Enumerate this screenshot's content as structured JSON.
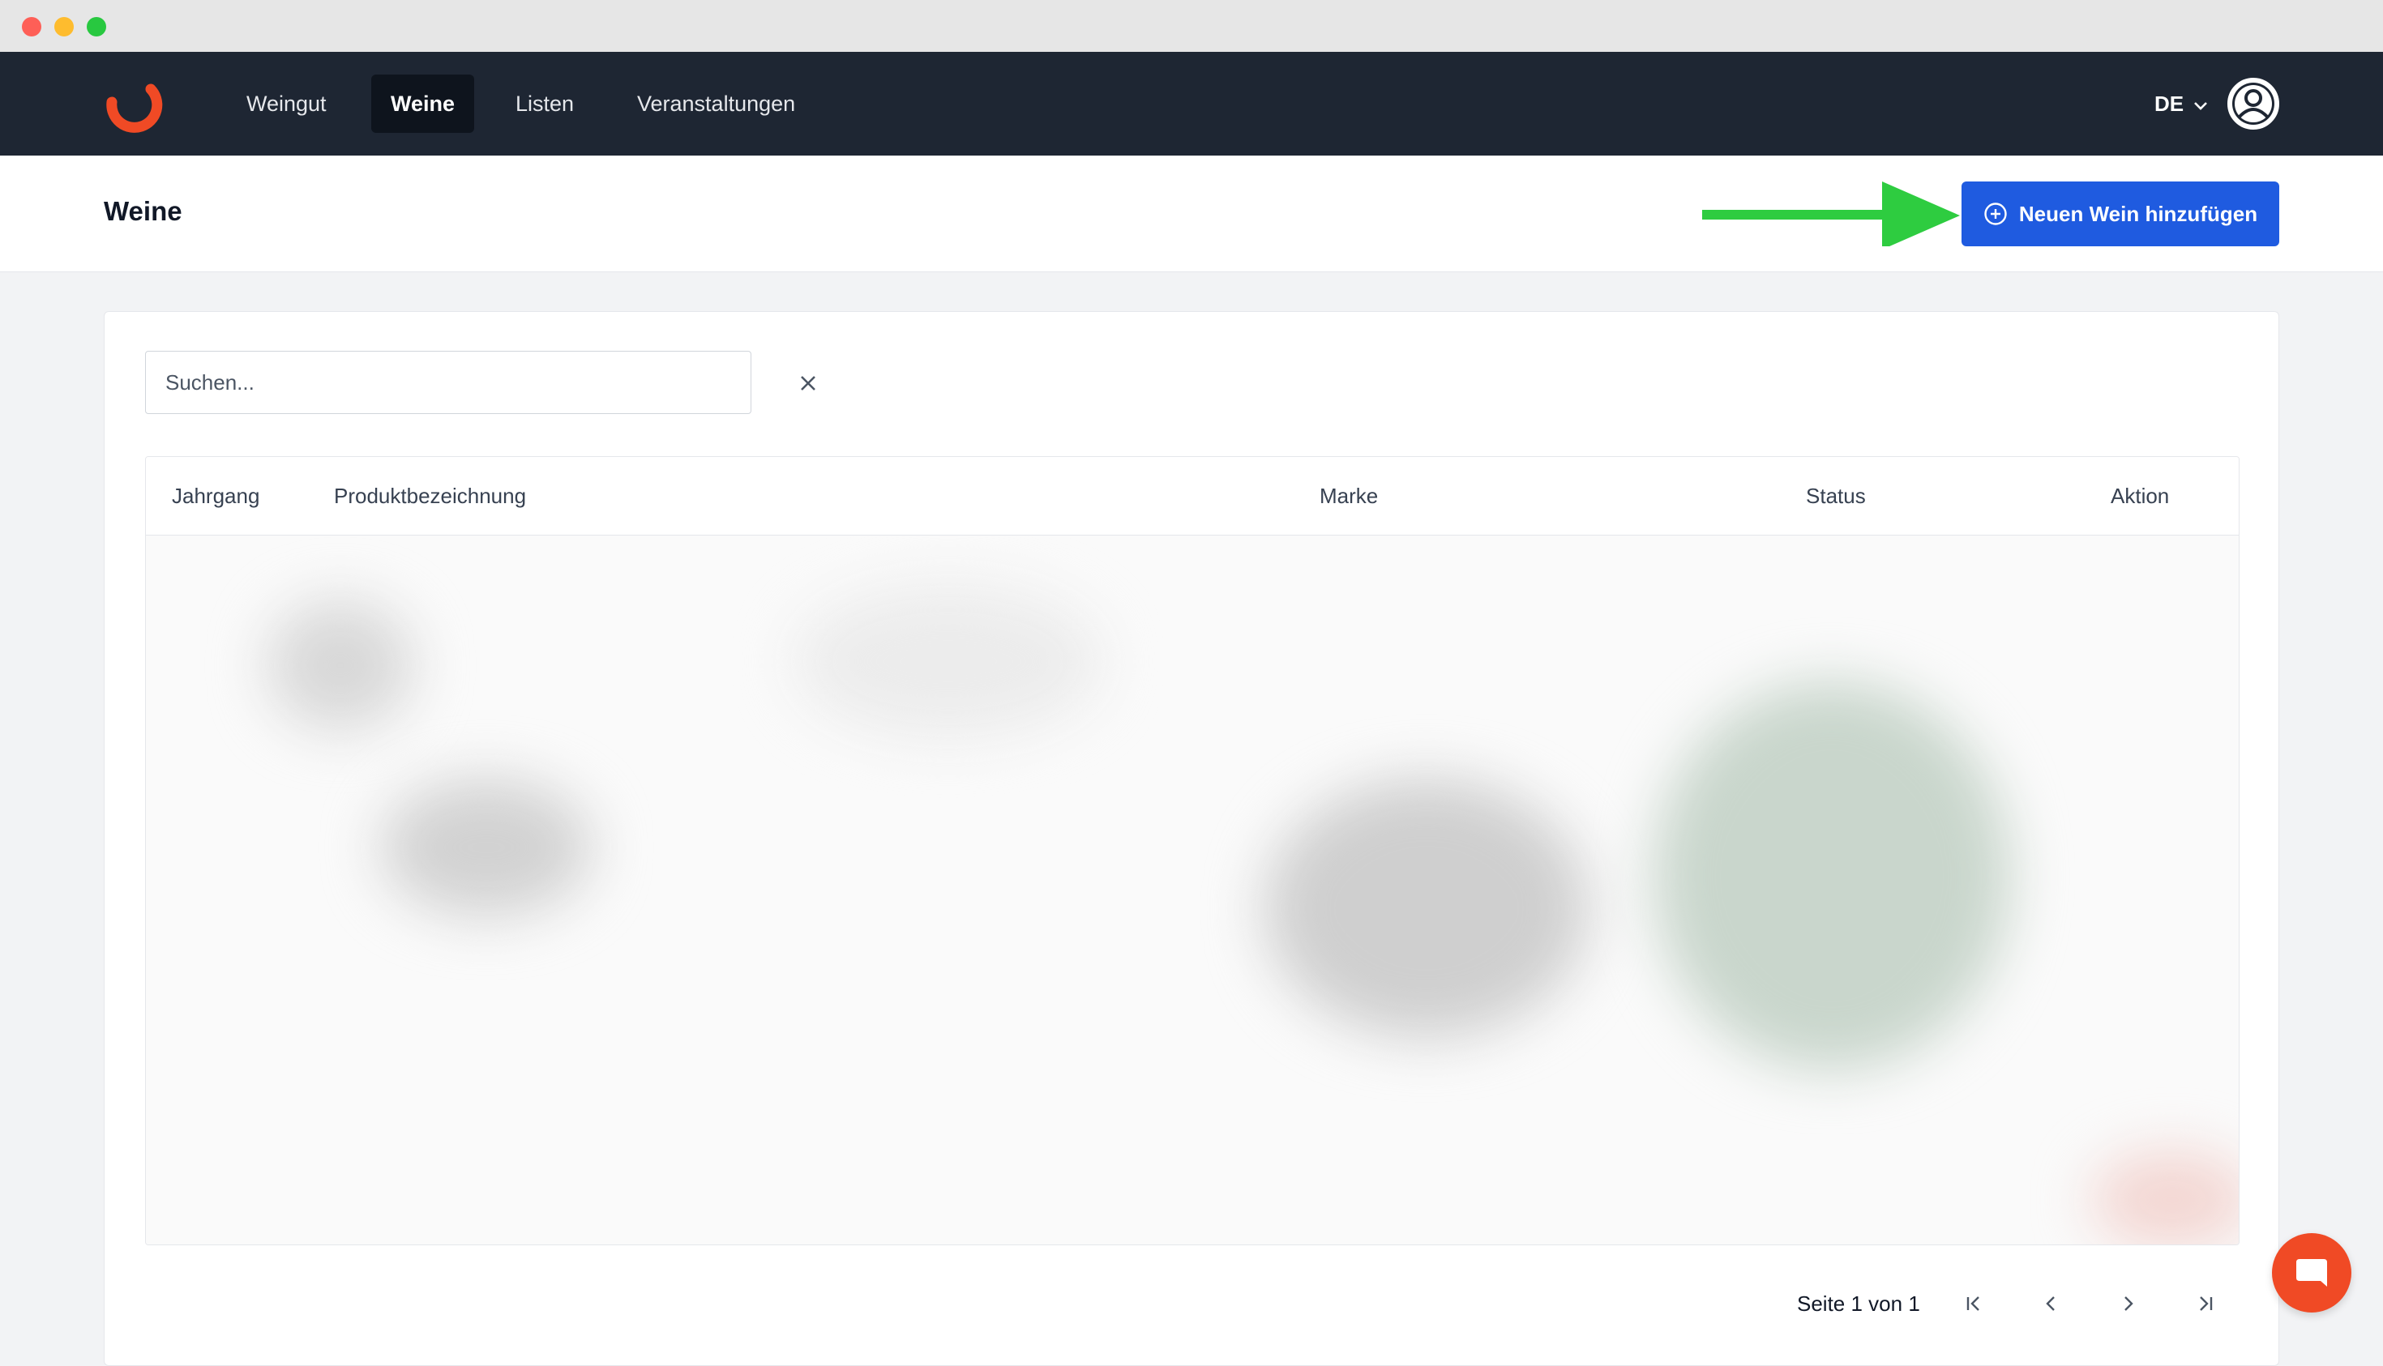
{
  "nav": {
    "items": [
      {
        "label": "Weingut"
      },
      {
        "label": "Weine"
      },
      {
        "label": "Listen"
      },
      {
        "label": "Veranstaltungen"
      }
    ],
    "language": "DE"
  },
  "header": {
    "title": "Weine",
    "add_button_label": "Neuen Wein hinzufügen"
  },
  "search": {
    "placeholder": "Suchen...",
    "value": ""
  },
  "table": {
    "columns": [
      "Jahrgang",
      "Produktbezeichnung",
      "Marke",
      "Status",
      "Aktion"
    ]
  },
  "pagination": {
    "label": "Seite 1 von 1"
  },
  "colors": {
    "navbar": "#1e2633",
    "primary": "#1f5be0",
    "brand": "#f04a25",
    "annotation_arrow": "#2ecc40"
  },
  "icons": {
    "logo": "brand-logo-icon",
    "add": "plus-circle-icon",
    "user": "user-circle-icon",
    "clear": "close-icon",
    "chat": "chat-icon"
  }
}
